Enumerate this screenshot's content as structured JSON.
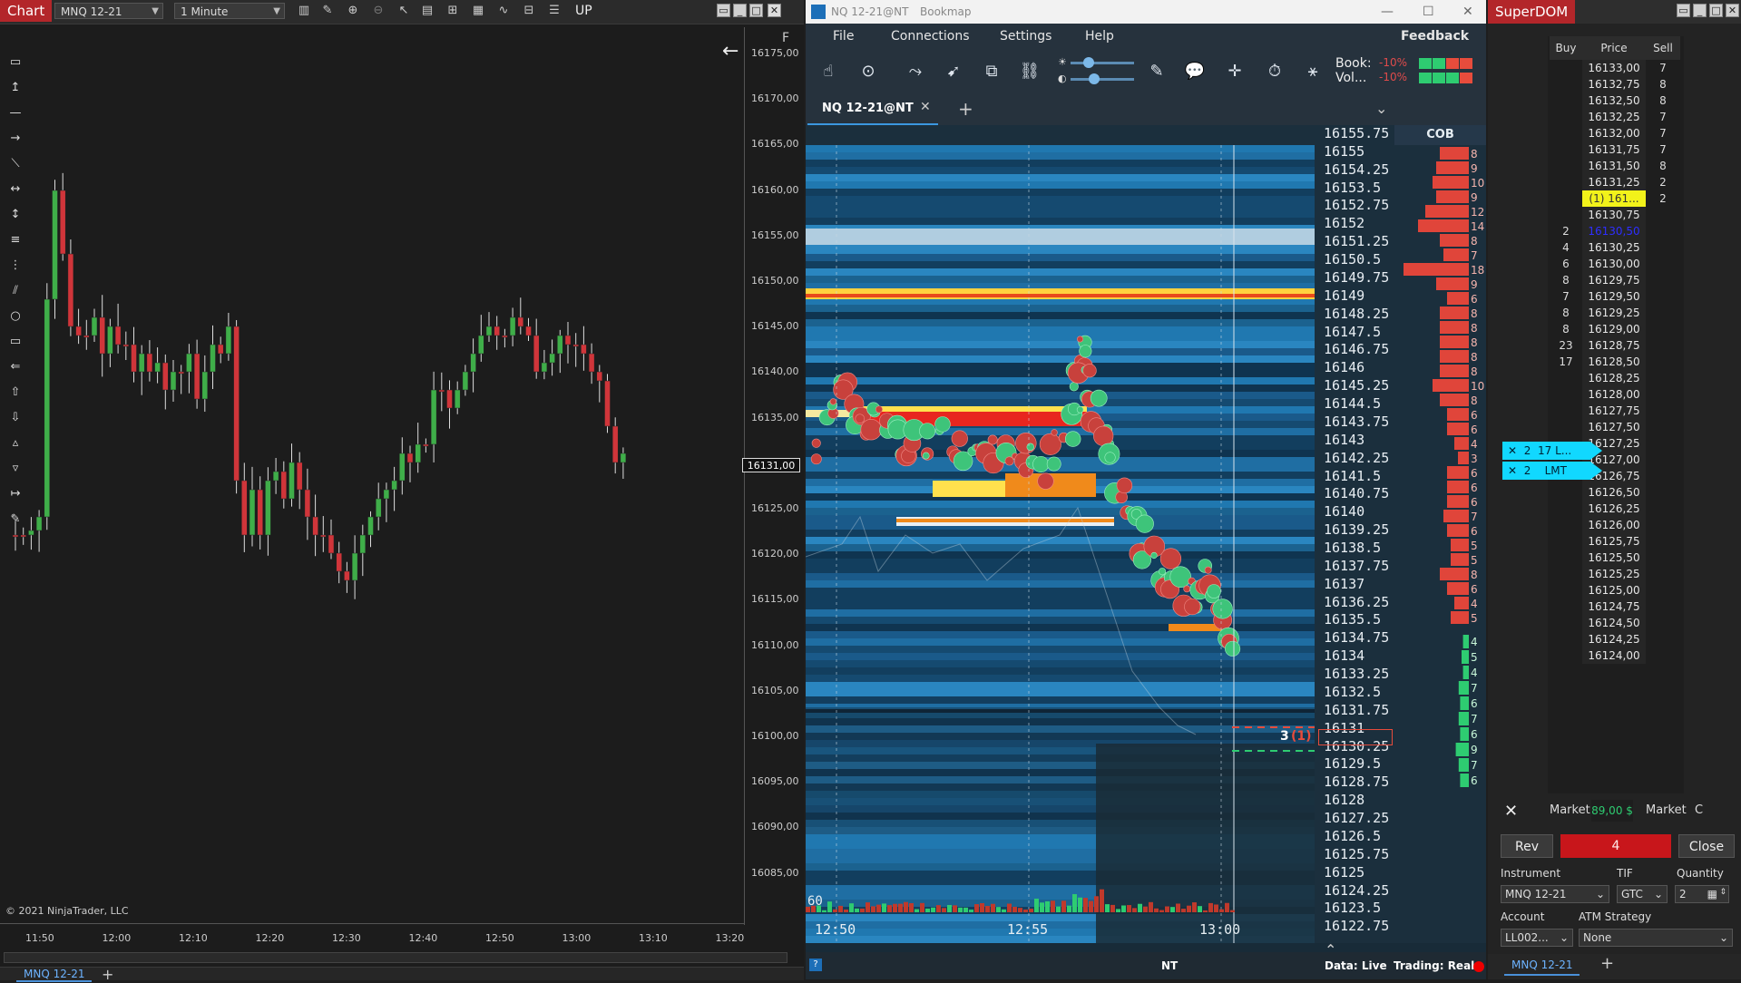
{
  "nt": {
    "tag": "Chart",
    "instrument": "MNQ 12-21",
    "interval": "1 Minute",
    "up_label": "UP",
    "f_label": "F",
    "price_ticks": [
      "16175,00",
      "16170,00",
      "16165,00",
      "16160,00",
      "16155,00",
      "16150,00",
      "16145,00",
      "16140,00",
      "16135,00",
      "16130,00",
      "16125,00",
      "16120,00",
      "16115,00",
      "16110,00",
      "16105,00",
      "16100,00",
      "16095,00",
      "16090,00",
      "16085,00"
    ],
    "time_ticks": [
      "11:50",
      "12:00",
      "12:10",
      "12:20",
      "12:30",
      "12:40",
      "12:50",
      "13:00",
      "13:10",
      "13:20"
    ],
    "last_price": "16131,00",
    "copyright": "© 2021 NinjaTrader, LLC",
    "bottom_tab": "MNQ 12-21",
    "add_tab": "+",
    "colors": {
      "bull": "#3fae49",
      "bear": "#d0353a"
    }
  },
  "bookmap": {
    "title_instr": "NQ 12-21@NT",
    "title_app": "Bookmap",
    "menu": [
      "File",
      "Connections",
      "Settings",
      "Help"
    ],
    "feedback": "Feedback",
    "book_label": "Book:",
    "book_pct": "-10%",
    "vol_label": "Vol...",
    "vol_pct": "-10%",
    "tab": "NQ 12-21@NT",
    "cob": "COB",
    "prices": [
      "16155.75",
      "16155",
      "16154.25",
      "16153.5",
      "16152.75",
      "16152",
      "16151.25",
      "16150.5",
      "16149.75",
      "16149",
      "16148.25",
      "16147.5",
      "16146.75",
      "16146",
      "16145.25",
      "16144.5",
      "16143.75",
      "16143",
      "16142.25",
      "16141.5",
      "16140.75",
      "16140",
      "16139.25",
      "16138.5",
      "16137.75",
      "16137",
      "16136.25",
      "16135.5",
      "16134.75",
      "16134",
      "16133.25",
      "16132.5",
      "16131.75",
      "16131",
      "16130.25",
      "16129.5",
      "16128.75",
      "16128",
      "16127.25",
      "16126.5",
      "16125.75",
      "16125",
      "16124.25",
      "16123.5",
      "16122.75"
    ],
    "cob_ask": [
      "8",
      "9",
      "10",
      "9",
      "12",
      "14",
      "8",
      "7",
      "18",
      "9",
      "6",
      "8",
      "8",
      "8",
      "8",
      "8",
      "10",
      "8",
      "6",
      "6",
      "4",
      "3",
      "6",
      "6",
      "6",
      "7",
      "6",
      "5",
      "5",
      "8",
      "6",
      "4",
      "5"
    ],
    "cob_bid": [
      "4",
      "5",
      "4",
      "7",
      "6",
      "7",
      "6",
      "9",
      "7",
      "6"
    ],
    "time_labels": [
      "12:50",
      "12:55",
      "13:00"
    ],
    "volume_scale": "60",
    "order_marker": "3",
    "order_marker_sub": "(1)",
    "status_feed": "NT",
    "status_data": "Data: Live",
    "status_trading": "Trading: Real"
  },
  "superdom": {
    "tag": "SuperDOM",
    "head_buy": "Buy",
    "head_price": "Price",
    "head_sell": "Sell",
    "rows": [
      {
        "buy": "",
        "price": "16133,00",
        "sell": "7"
      },
      {
        "buy": "",
        "price": "16132,75",
        "sell": "8"
      },
      {
        "buy": "",
        "price": "16132,50",
        "sell": "8"
      },
      {
        "buy": "",
        "price": "16132,25",
        "sell": "7"
      },
      {
        "buy": "",
        "price": "16132,00",
        "sell": "7"
      },
      {
        "buy": "",
        "price": "16131,75",
        "sell": "7"
      },
      {
        "buy": "",
        "price": "16131,50",
        "sell": "8"
      },
      {
        "buy": "",
        "price": "16131,25",
        "sell": "2"
      },
      {
        "buy": "",
        "price": "(1) 161...",
        "sell": "2"
      },
      {
        "buy": "",
        "price": "16130,75",
        "sell": ""
      },
      {
        "buy": "2",
        "price": "16130,50",
        "sell": ""
      },
      {
        "buy": "4",
        "price": "16130,25",
        "sell": ""
      },
      {
        "buy": "6",
        "price": "16130,00",
        "sell": ""
      },
      {
        "buy": "8",
        "price": "16129,75",
        "sell": ""
      },
      {
        "buy": "7",
        "price": "16129,50",
        "sell": ""
      },
      {
        "buy": "8",
        "price": "16129,25",
        "sell": ""
      },
      {
        "buy": "8",
        "price": "16129,00",
        "sell": ""
      },
      {
        "buy": "23",
        "price": "16128,75",
        "sell": ""
      },
      {
        "buy": "17",
        "price": "16128,50",
        "sell": ""
      },
      {
        "buy": "",
        "price": "16128,25",
        "sell": ""
      },
      {
        "buy": "",
        "price": "16128,00",
        "sell": ""
      },
      {
        "buy": "",
        "price": "16127,75",
        "sell": ""
      },
      {
        "buy": "",
        "price": "16127,50",
        "sell": ""
      },
      {
        "buy": "",
        "price": "16127,25",
        "sell": ""
      },
      {
        "buy": "",
        "price": "16127,00",
        "sell": ""
      },
      {
        "buy": "",
        "price": "16126,75",
        "sell": ""
      },
      {
        "buy": "",
        "price": "16126,50",
        "sell": ""
      },
      {
        "buy": "",
        "price": "16126,25",
        "sell": ""
      },
      {
        "buy": "",
        "price": "16126,00",
        "sell": ""
      },
      {
        "buy": "",
        "price": "16125,75",
        "sell": ""
      },
      {
        "buy": "",
        "price": "16125,50",
        "sell": ""
      },
      {
        "buy": "",
        "price": "16125,25",
        "sell": ""
      },
      {
        "buy": "",
        "price": "16125,00",
        "sell": ""
      },
      {
        "buy": "",
        "price": "16124,75",
        "sell": ""
      },
      {
        "buy": "",
        "price": "16124,50",
        "sell": ""
      },
      {
        "buy": "",
        "price": "16124,25",
        "sell": ""
      },
      {
        "buy": "",
        "price": "16124,00",
        "sell": ""
      }
    ],
    "order1": {
      "qty": "2",
      "label": "17 L..."
    },
    "order2": {
      "qty": "2",
      "label": "LMT"
    },
    "market_left": "Market",
    "pnl": "89,00 $",
    "market_right": "Market",
    "c_label": "C",
    "rev": "Rev",
    "position": "4",
    "close": "Close",
    "instrument_label": "Instrument",
    "tif_label": "TIF",
    "quantity_label": "Quantity",
    "instrument": "MNQ 12-21",
    "tif": "GTC",
    "quantity": "2",
    "account_label": "Account",
    "atm_label": "ATM Strategy",
    "account": "LL002...",
    "atm": "None",
    "bottom_tab": "MNQ 12-21",
    "add_tab": "+"
  }
}
